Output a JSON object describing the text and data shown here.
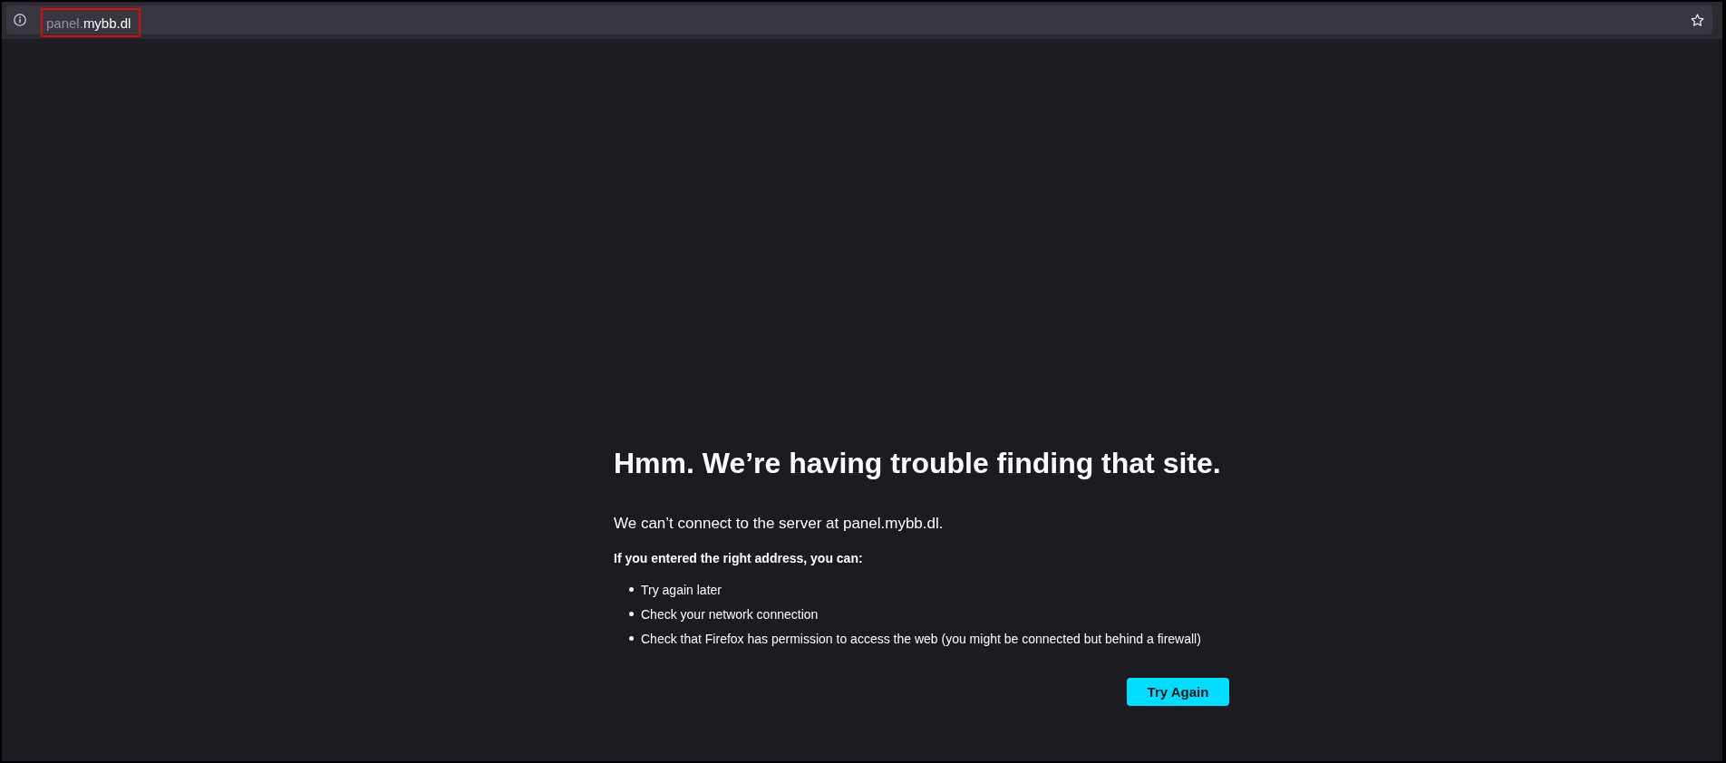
{
  "toolbar": {
    "url": {
      "subdomain": "panel.",
      "domain": "mybb.dl"
    },
    "url_annotated": true
  },
  "error": {
    "title": "Hmm. We’re having trouble finding that site.",
    "message": "We can’t connect to the server at panel.mybb.dl.",
    "advice_heading": "If you entered the right address, you can:",
    "suggestions": [
      "Try again later",
      "Check your network connection",
      "Check that Firefox has permission to access the web (you might be connected but behind a firewall)"
    ],
    "button": "Try Again"
  }
}
